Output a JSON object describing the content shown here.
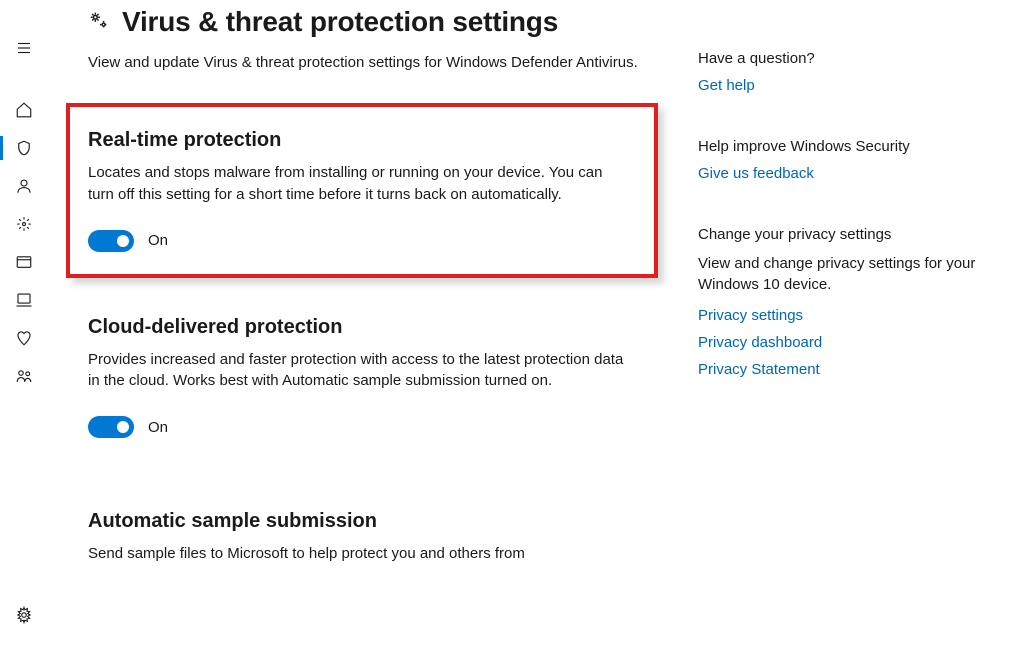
{
  "colors": {
    "accent": "#0078D4",
    "link": "#0066b4",
    "highlight_border": "#e02020"
  },
  "rail": {
    "items": [
      {
        "name": "menu-icon"
      },
      {
        "name": "home-icon"
      },
      {
        "name": "shield-icon",
        "active": true
      },
      {
        "name": "account-icon"
      },
      {
        "name": "firewall-icon"
      },
      {
        "name": "app-browser-icon"
      },
      {
        "name": "device-security-icon"
      },
      {
        "name": "device-health-icon"
      },
      {
        "name": "family-icon"
      }
    ],
    "bottom": {
      "name": "settings-icon"
    }
  },
  "header": {
    "title": "Virus & threat protection settings",
    "subtitle": "View and update Virus & threat protection settings for Windows Defender Antivirus."
  },
  "sections": [
    {
      "title": "Real-time protection",
      "desc": "Locates and stops malware from installing or running on your device. You can turn off this setting for a short time before it turns back on automatically.",
      "toggle_state": "On",
      "highlighted": true
    },
    {
      "title": "Cloud-delivered protection",
      "desc": "Provides increased and faster protection with access to the latest protection data in the cloud. Works best with Automatic sample submission turned on.",
      "toggle_state": "On",
      "highlighted": false
    },
    {
      "title": "Automatic sample submission",
      "desc": "Send sample files to Microsoft to help protect you and others from",
      "toggle_state": "",
      "highlighted": false
    }
  ],
  "side": {
    "question": {
      "heading": "Have a question?",
      "link": "Get help"
    },
    "improve": {
      "heading": "Help improve Windows Security",
      "link": "Give us feedback"
    },
    "privacy": {
      "heading": "Change your privacy settings",
      "desc": "View and change privacy settings for your Windows 10 device.",
      "links": [
        "Privacy settings",
        "Privacy dashboard",
        "Privacy Statement"
      ]
    }
  }
}
